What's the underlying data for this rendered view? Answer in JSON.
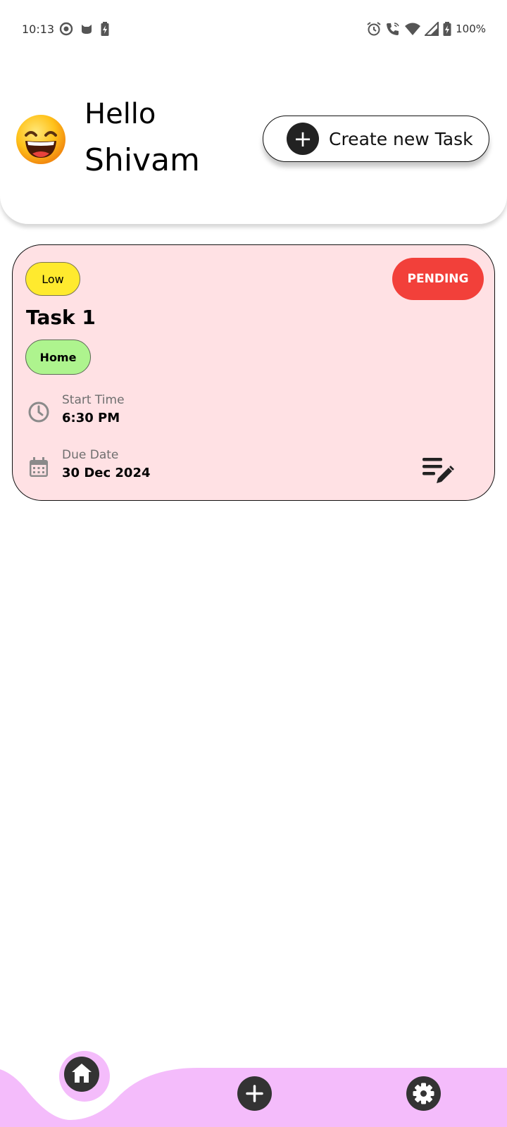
{
  "status_bar": {
    "time": "10:13",
    "battery_percent": "100%",
    "left_icons": [
      "record-icon",
      "cat-icon",
      "battery-charging-icon"
    ],
    "right_icons": [
      "alarm-icon",
      "wifi-call-icon",
      "wifi-icon",
      "signal-icon",
      "battery-icon"
    ]
  },
  "header": {
    "greeting": "Hello",
    "user_name": "Shivam",
    "avatar": "grinning-emoji-icon",
    "create_button_label": "Create new Task"
  },
  "tasks": [
    {
      "priority": "Low",
      "status": "PENDING",
      "title": "Task 1",
      "category": "Home",
      "start_time_label": "Start Time",
      "start_time": "6:30 PM",
      "due_date_label": "Due Date",
      "due_date": "30 Dec 2024",
      "edit_icon": "edit-notes-icon"
    }
  ],
  "bottom_nav": {
    "items": [
      "home-icon",
      "add-icon",
      "settings-icon"
    ],
    "active": "home"
  },
  "colors": {
    "card_background": "#ffe1e4",
    "priority_low": "#ffea2e",
    "status_pending": "#f2403a",
    "category_home": "#aef48e",
    "nav_background": "#f4bcfb",
    "icon_dark": "#333333"
  }
}
